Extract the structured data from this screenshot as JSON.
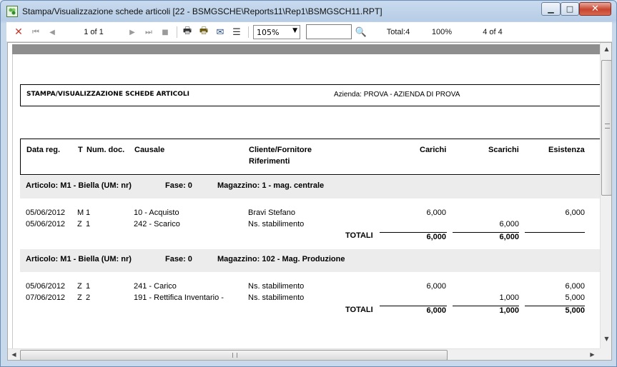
{
  "window": {
    "title": "Stampa/Visualizzazione schede articoli [22 - BSMGSCHE\\Reports11\\Rep1\\BSMGSCH11.RPT]",
    "minimize": "▁",
    "maximize": "□",
    "close": "✕"
  },
  "toolbar": {
    "close_glyph": "✕",
    "first_glyph": "⏮",
    "prev_glyph": "◀",
    "page_indicator": "1 of 1",
    "next_glyph": "▶",
    "last_glyph": "⏭",
    "stop_glyph": "■",
    "print_glyph": "🖶",
    "print_setup_glyph": "🖶",
    "export_glyph": "✉",
    "tree_glyph": "☰",
    "zoom_value": "105%",
    "search_value": "",
    "find_glyph": "🔍",
    "total": "Total:4",
    "percent": "100%",
    "count": "4 of 4"
  },
  "report": {
    "title": "STAMPA/VISUALIZZAZIONE SCHEDE ARTICOLI",
    "azienda": "Azienda: PROVA - AZIENDA DI PROVA",
    "columns": {
      "data_reg": "Data reg.",
      "t": "T",
      "num_doc": "Num. doc.",
      "causale": "Causale",
      "cliente": "Cliente/Fornitore",
      "riferimenti": "Riferimenti",
      "carichi": "Carichi",
      "scarichi": "Scarichi",
      "esistenza": "Esistenza"
    },
    "groups": [
      {
        "articolo": "Articolo: M1 - Biella (UM: nr)",
        "fase": "Fase: 0",
        "magazzino": "Magazzino: 1 - mag. centrale",
        "rows": [
          {
            "data": "05/06/2012",
            "t": "M",
            "num": "1",
            "causale": "10 - Acquisto",
            "cliente": "Bravi Stefano",
            "carichi": "6,000",
            "scarichi": "",
            "esistenza": "6,000"
          },
          {
            "data": "05/06/2012",
            "t": "Z",
            "num": "1",
            "causale": "242 - Scarico",
            "cliente": "Ns. stabilimento",
            "carichi": "",
            "scarichi": "6,000",
            "esistenza": ""
          }
        ],
        "totali_label": "TOTALI",
        "totali": {
          "carichi": "6,000",
          "scarichi": "6,000",
          "esistenza": ""
        }
      },
      {
        "articolo": "Articolo: M1 - Biella (UM: nr)",
        "fase": "Fase: 0",
        "magazzino": "Magazzino: 102 - Mag. Produzione",
        "rows": [
          {
            "data": "05/06/2012",
            "t": "Z",
            "num": "1",
            "causale": "241 - Carico",
            "cliente": "Ns. stabilimento",
            "carichi": "6,000",
            "scarichi": "",
            "esistenza": "6,000"
          },
          {
            "data": "07/06/2012",
            "t": "Z",
            "num": "2",
            "causale": "191 - Rettifica Inventario -",
            "cliente": "Ns. stabilimento",
            "carichi": "",
            "scarichi": "1,000",
            "esistenza": "5,000"
          }
        ],
        "totali_label": "TOTALI",
        "totali": {
          "carichi": "6,000",
          "scarichi": "1,000",
          "esistenza": "5,000"
        }
      }
    ]
  },
  "scrollbars": {
    "up": "▲",
    "down": "▼",
    "left": "◀",
    "right": "▶"
  }
}
